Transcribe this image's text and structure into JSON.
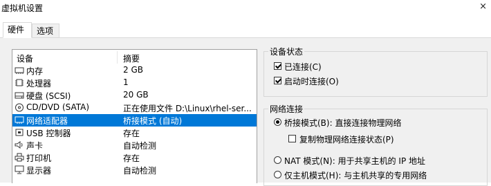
{
  "window": {
    "title": "虚拟机设置",
    "close_glyph": "×"
  },
  "tabs": [
    {
      "label": "硬件",
      "active": true
    },
    {
      "label": "选项",
      "active": false
    }
  ],
  "devices": {
    "header": {
      "device": "设备",
      "summary": "摘要"
    },
    "rows": [
      {
        "icon": "memory-icon",
        "name": "内存",
        "summary": "2 GB"
      },
      {
        "icon": "cpu-icon",
        "name": "处理器",
        "summary": "1"
      },
      {
        "icon": "harddisk-icon",
        "name": "硬盘 (SCSI)",
        "summary": "20 GB"
      },
      {
        "icon": "cd-dvd-icon",
        "name": "CD/DVD (SATA)",
        "summary": "正在使用文件 D:\\Linux\\rhel-ser..."
      },
      {
        "icon": "network-adapter-icon",
        "name": "网络适配器",
        "summary": "桥接模式 (自动)",
        "selected": true
      },
      {
        "icon": "usb-controller-icon",
        "name": "USB 控制器",
        "summary": "存在"
      },
      {
        "icon": "sound-card-icon",
        "name": "声卡",
        "summary": "自动检测"
      },
      {
        "icon": "printer-icon",
        "name": "打印机",
        "summary": "存在"
      },
      {
        "icon": "display-icon",
        "name": "显示器",
        "summary": "自动检测"
      }
    ]
  },
  "device_status": {
    "title": "设备状态",
    "connected": {
      "label": "已连接(C)",
      "checked": true
    },
    "connect_at_power_on": {
      "label": "启动时连接(O)",
      "checked": true
    }
  },
  "network_connection": {
    "title": "网络连接",
    "bridged": {
      "label": "桥接模式(B): 直接连接物理网络",
      "checked": true
    },
    "replicate_state": {
      "label": "复制物理网络连接状态(P)",
      "checked": false
    },
    "nat": {
      "label": "NAT 模式(N): 用于共享主机的 IP 地址",
      "checked": false
    },
    "host_only": {
      "label": "仅主机模式(H): 与主机共享的专用网络",
      "checked": false
    }
  }
}
